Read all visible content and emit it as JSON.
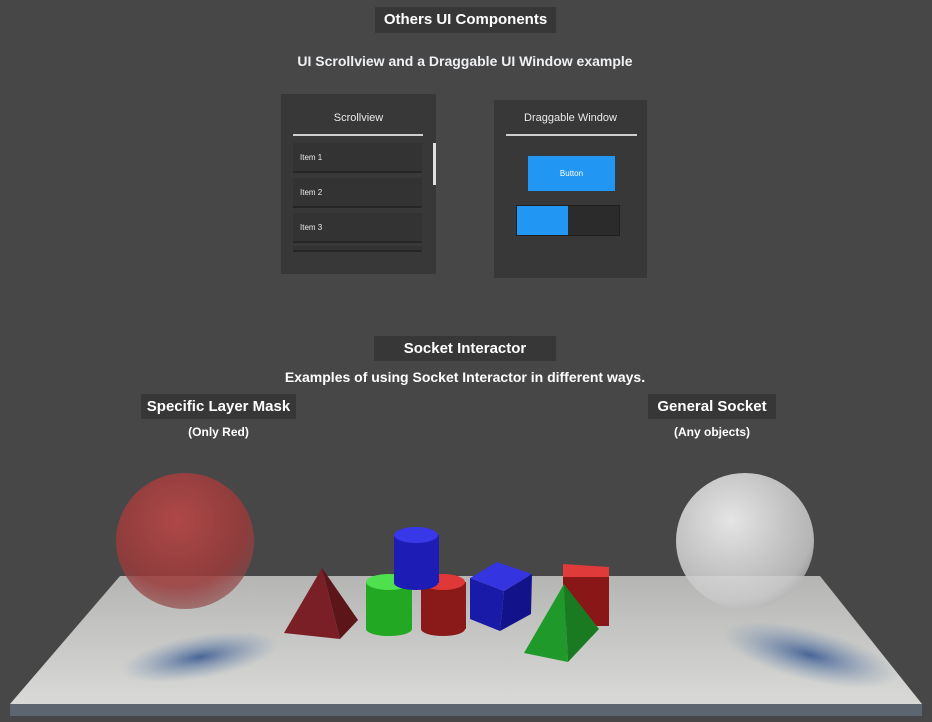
{
  "ui_section": {
    "title": "Others UI Components",
    "subtitle": "UI Scrollview and a Draggable UI Window example"
  },
  "scrollview": {
    "title": "Scrollview",
    "items": [
      "Item 1",
      "Item 2",
      "Item 3"
    ]
  },
  "draggable_window": {
    "title": "Draggable Window",
    "button_label": "Button",
    "slider_value": 0.5,
    "accent_color": "#2196f3"
  },
  "socket_section": {
    "title": "Socket Interactor",
    "subtitle": "Examples of using Socket Interactor in different ways."
  },
  "sockets": {
    "specific": {
      "title": "Specific Layer Mask",
      "note": "(Only Red)",
      "color": "#c23a3a"
    },
    "general": {
      "title": "General Socket",
      "note": "(Any objects)",
      "color": "#e6e6e6"
    }
  },
  "scene_objects": [
    "red-pyramid",
    "green-cylinder",
    "red-cylinder",
    "blue-cylinder",
    "blue-cube",
    "red-cube",
    "green-pyramid"
  ]
}
